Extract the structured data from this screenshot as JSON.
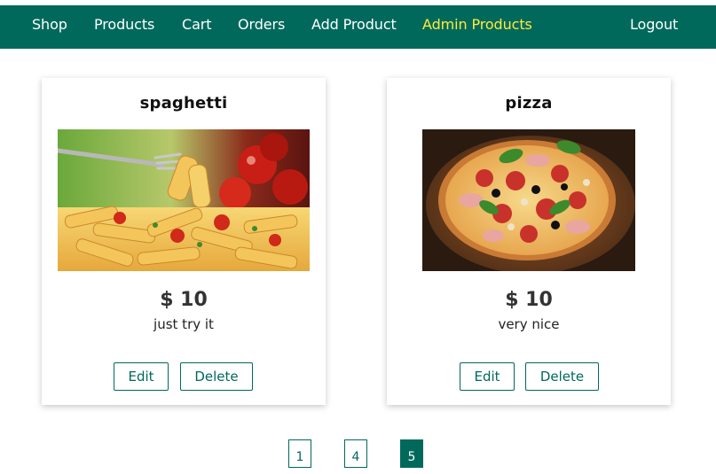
{
  "nav": {
    "items": [
      {
        "label": "Shop",
        "active": false
      },
      {
        "label": "Products",
        "active": false
      },
      {
        "label": "Cart",
        "active": false
      },
      {
        "label": "Orders",
        "active": false
      },
      {
        "label": "Add Product",
        "active": false
      },
      {
        "label": "Admin Products",
        "active": true
      }
    ],
    "logout": "Logout"
  },
  "products": [
    {
      "title": "spaghetti",
      "price": "$ 10",
      "description": "just try it",
      "edit_label": "Edit",
      "delete_label": "Delete"
    },
    {
      "title": "pizza",
      "price": "$ 10",
      "description": "very nice",
      "edit_label": "Edit",
      "delete_label": "Delete"
    }
  ],
  "pagination": {
    "pages": [
      "1",
      "4",
      "5"
    ],
    "current": "5"
  },
  "colors": {
    "primary": "#00695c",
    "active_nav": "#ffeb3b"
  }
}
